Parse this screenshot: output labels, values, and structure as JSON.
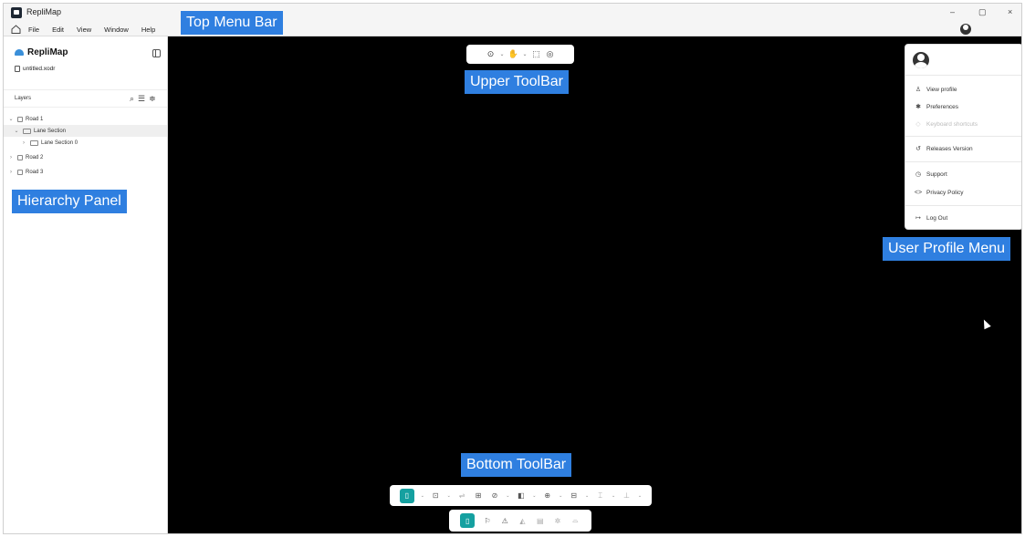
{
  "window": {
    "app_title": "RepliMap",
    "menu": [
      "File",
      "Edit",
      "View",
      "Window",
      "Help"
    ],
    "controls": {
      "minimize": "–",
      "maximize": "▢",
      "close": "×"
    }
  },
  "sidebar": {
    "brand": "RepliMap",
    "file_name": "untitled.xodr",
    "layers_tab": "Layers",
    "tree": [
      {
        "label": "Road 1",
        "caret": "⌄",
        "indent": 0
      },
      {
        "label": "Lane Section",
        "caret": "⌄",
        "indent": 1,
        "selected": true
      },
      {
        "label": "Lane Section 0",
        "caret": "›",
        "indent": 2
      },
      {
        "label": "Road 2",
        "caret": "›",
        "indent": 0
      },
      {
        "label": "Road 3",
        "caret": "›",
        "indent": 0
      }
    ]
  },
  "profile_menu": {
    "items": [
      {
        "label": "View profile",
        "icon": "person-icon",
        "glyph": "♙"
      },
      {
        "label": "Preferences",
        "icon": "gear-icon",
        "glyph": "✱"
      },
      {
        "label": "Keyboard shortcuts",
        "icon": "keyboard-icon",
        "glyph": "◇",
        "disabled": true
      },
      {
        "label": "Releases Version",
        "icon": "history-icon",
        "glyph": "↺"
      },
      {
        "label": "Support",
        "icon": "clock-icon",
        "glyph": "◷"
      },
      {
        "label": "Privacy Policy",
        "icon": "code-icon",
        "glyph": "<>"
      },
      {
        "label": "Log Out",
        "icon": "logout-icon",
        "glyph": "↦"
      }
    ]
  },
  "annotations": {
    "top_menu_bar": "Top Menu Bar",
    "upper_toolbar": "Upper ToolBar",
    "hierarchy_panel": "Hierarchy Panel",
    "user_profile_menu": "User Profile Menu",
    "bottom_toolbar": "Bottom ToolBar"
  },
  "colors": {
    "accent": "#15a0a0",
    "callout": "#2f7fe0",
    "canvas": "#000000"
  }
}
